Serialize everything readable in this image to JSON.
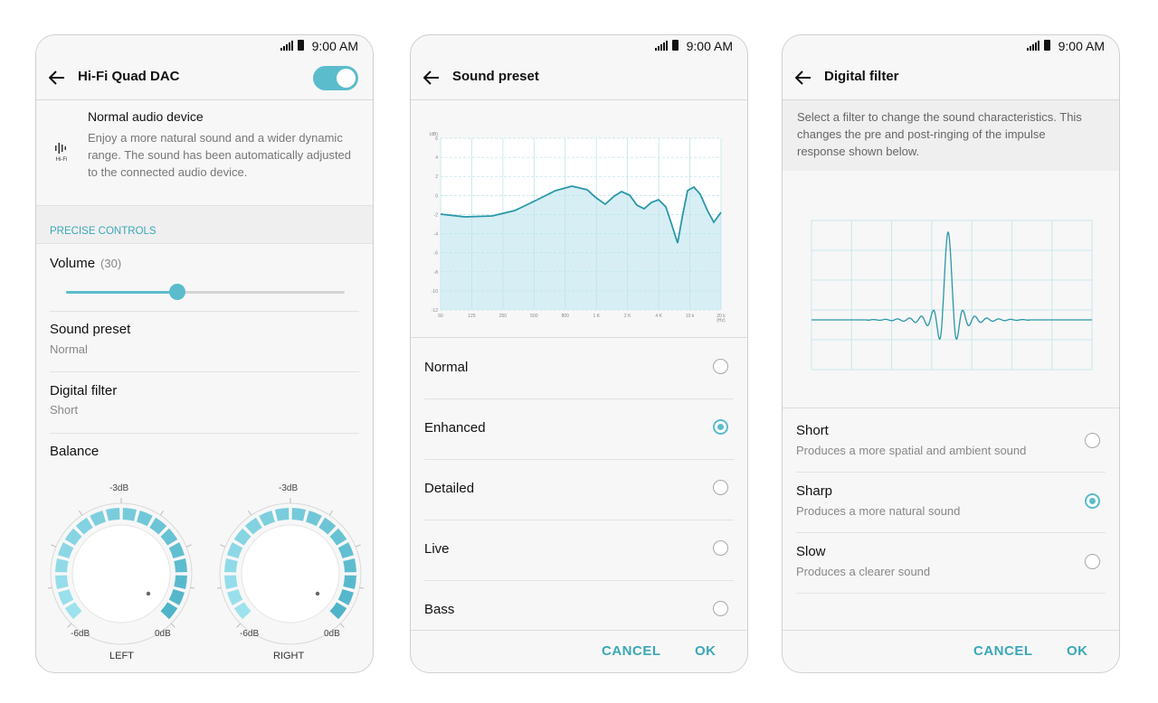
{
  "status": {
    "time": "9:00 AM"
  },
  "screen1": {
    "title": "Hi-Fi Quad DAC",
    "toggle_on": true,
    "device": {
      "icon_label": "Hi-Fi",
      "title": "Normal audio device",
      "description": "Enjoy a more natural sound and a wider dynamic range. The sound has been automatically adjusted to the connected audio device."
    },
    "section_label": "PRECISE CONTROLS",
    "volume": {
      "label": "Volume",
      "value_text": "(30)",
      "fraction": 0.4
    },
    "sound_preset": {
      "label": "Sound preset",
      "value": "Normal"
    },
    "digital_filter": {
      "label": "Digital filter",
      "value": "Short"
    },
    "balance": {
      "label": "Balance",
      "left": {
        "caption": "LEFT",
        "top": "-3dB",
        "min": "-6dB",
        "max": "0dB"
      },
      "right": {
        "caption": "RIGHT",
        "top": "-3dB",
        "min": "-6dB",
        "max": "0dB"
      }
    }
  },
  "screen2": {
    "title": "Sound preset",
    "chart": {
      "unit": "(dB)",
      "y_ticks": [
        "6",
        "4",
        "2",
        "0",
        "-2",
        "-4",
        "-6",
        "-8",
        "-10",
        "-12"
      ],
      "x_ticks": [
        "60",
        "125",
        "250",
        "500",
        "800",
        "1 K",
        "2 K",
        "4 K",
        "10 k",
        "20 k"
      ],
      "x_unit": "(Hz)"
    },
    "options": [
      "Normal",
      "Enhanced",
      "Detailed",
      "Live",
      "Bass"
    ],
    "selected": 1,
    "cancel": "CANCEL",
    "ok": "OK"
  },
  "screen3": {
    "title": "Digital filter",
    "intro": "Select a filter to change the sound characteristics. This changes the pre and post-ringing of the impulse response shown below.",
    "filters": [
      {
        "title": "Short",
        "desc": "Produces a more spatial and ambient sound"
      },
      {
        "title": "Sharp",
        "desc": "Produces a more natural sound"
      },
      {
        "title": "Slow",
        "desc": "Produces a clearer sound"
      }
    ],
    "selected": 1,
    "cancel": "CANCEL",
    "ok": "OK"
  },
  "colors": {
    "accent": "#5bbccc",
    "accent_text": "#3ba7b8"
  }
}
